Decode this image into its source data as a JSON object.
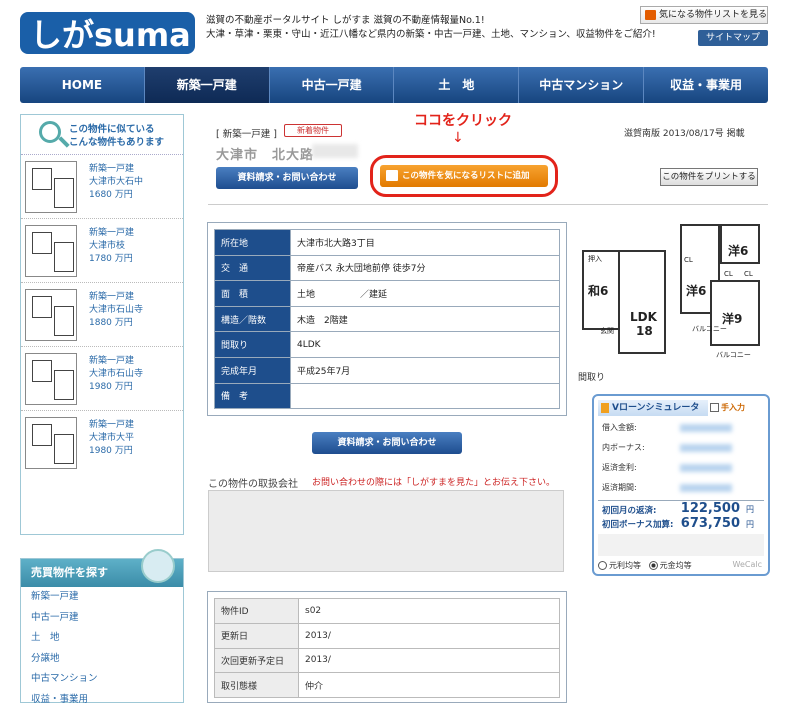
{
  "header": {
    "logo_text": "しがsuma",
    "tagline_1": "滋賀の不動産ポータルサイト しがすま 滋賀の不動産情報量No.1!",
    "tagline_2": "大津・草津・栗東・守山・近江八幡など県内の新築・中古一戸建、土地、マンション、収益物件をご紹介!",
    "favorite_list_button": "気になる物件リストを見る",
    "sitemap_button": "サイトマップ"
  },
  "nav": [
    {
      "label": "HOME",
      "active": false
    },
    {
      "label": "新築一戸建",
      "active": true
    },
    {
      "label": "中古一戸建",
      "active": false
    },
    {
      "label": "土　地",
      "active": false
    },
    {
      "label": "中古マンション",
      "active": false
    },
    {
      "label": "収益・事業用",
      "active": false
    }
  ],
  "sidebar": {
    "similar_heading_1": "この物件に似ている",
    "similar_heading_2": "こんな物件もあります",
    "items": [
      {
        "type": "新築一戸建",
        "location": "大津市大石中",
        "price": "1680 万円"
      },
      {
        "type": "新築一戸建",
        "location": "大津市枝",
        "price": "1780 万円"
      },
      {
        "type": "新築一戸建",
        "location": "大津市石山寺",
        "price": "1880 万円"
      },
      {
        "type": "新築一戸建",
        "location": "大津市石山寺",
        "price": "1980 万円"
      },
      {
        "type": "新築一戸建",
        "location": "大津市大平",
        "price": "1980 万円"
      }
    ],
    "search_heading": "売買物件を探す",
    "search_links": [
      "新築一戸建",
      "中古一戸建",
      "土　地",
      "分譲地",
      "中古マンション",
      "収益・事業用"
    ]
  },
  "main": {
    "category": "[ 新築一戸建 ]",
    "new_badge": "新着物件",
    "title": "大津市　北大路",
    "published": "滋賀南版 2013/08/17号 掲載",
    "annotation": "ココをクリック",
    "annotation_arrow": "↓",
    "contact_button": "資料請求・お問い合わせ",
    "add_favorite_button": "この物件を気になるリストに追加",
    "print_button": "この物件をプリントする",
    "spec": [
      {
        "key": "所在地",
        "value": "大津市北大路3丁目"
      },
      {
        "key": "交　通",
        "value": "帝産バス 永大団地前停 徒歩7分"
      },
      {
        "key": "面　積",
        "value": "土地　　　　　／建延"
      },
      {
        "key": "構造／階数",
        "value": "木造　2階建"
      },
      {
        "key": "間取り",
        "value": "4LDK"
      },
      {
        "key": "完成年月",
        "value": "平成25年7月"
      },
      {
        "key": "備　考",
        "value": ""
      }
    ],
    "contact_button_2": "資料請求・お問い合わせ",
    "dealer_label": "この物件の取扱会社",
    "dealer_note": "お問い合わせの際には「しがすまを見た」とお伝え下さい。",
    "info": [
      {
        "key": "物件ID",
        "value": "s02"
      },
      {
        "key": "更新日",
        "value": "2013/"
      },
      {
        "key": "次回更新予定日",
        "value": "2013/"
      },
      {
        "key": "取引態様",
        "value": "仲介"
      }
    ]
  },
  "floorplan": {
    "caption": "間取り",
    "rooms": [
      "和6",
      "LDK",
      "18",
      "洋6",
      "洋6",
      "洋9",
      "押入",
      "CL",
      "CL",
      "CL",
      "玄関",
      "バルコニー",
      "バルコニー"
    ]
  },
  "loan": {
    "title": "Vローンシミュレータ",
    "manual": "手入力",
    "rows": [
      "借入金額:",
      "内ボーナス:",
      "返済金利:",
      "返済期間:"
    ],
    "monthly_label": "初回月の返済:",
    "monthly_value": "122,500",
    "bonus_label": "初回ボーナス加算:",
    "bonus_value": "673,750",
    "unit": "円",
    "option_1": "元利均等",
    "option_2": "元金均等",
    "brand": "WeCalc",
    "selected_option": "元金均等"
  }
}
